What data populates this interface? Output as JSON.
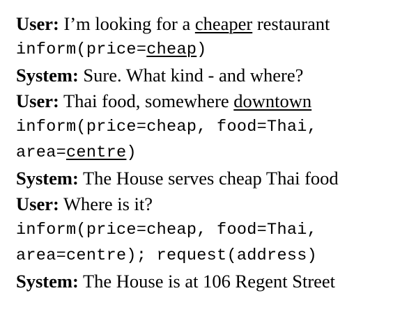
{
  "turns": [
    {
      "speaker": "User:",
      "pre": "I’m looking for a",
      "highlight": "cheaper",
      "post": "restaurant"
    },
    {
      "pre": "inform(price=",
      "highlight": "cheap",
      "post": ")"
    },
    {
      "speaker": "System:",
      "text": "Sure. What kind - and where?"
    },
    {
      "speaker": "User:",
      "pre": "Thai food, somewhere",
      "highlight": "downtown"
    },
    {
      "line1": "inform(price=cheap, food=Thai,",
      "line2_pre": "area=",
      "line2_highlight": "centre",
      "line2_post": ")"
    },
    {
      "speaker": "System:",
      "text": "The House serves cheap Thai food"
    },
    {
      "speaker": "User:",
      "text": "Where is it?"
    },
    {
      "line1": "inform(price=cheap, food=Thai,",
      "line2": "area=centre); request(address)"
    },
    {
      "speaker": "System:",
      "text": "The House is at 106 Regent Street"
    }
  ]
}
